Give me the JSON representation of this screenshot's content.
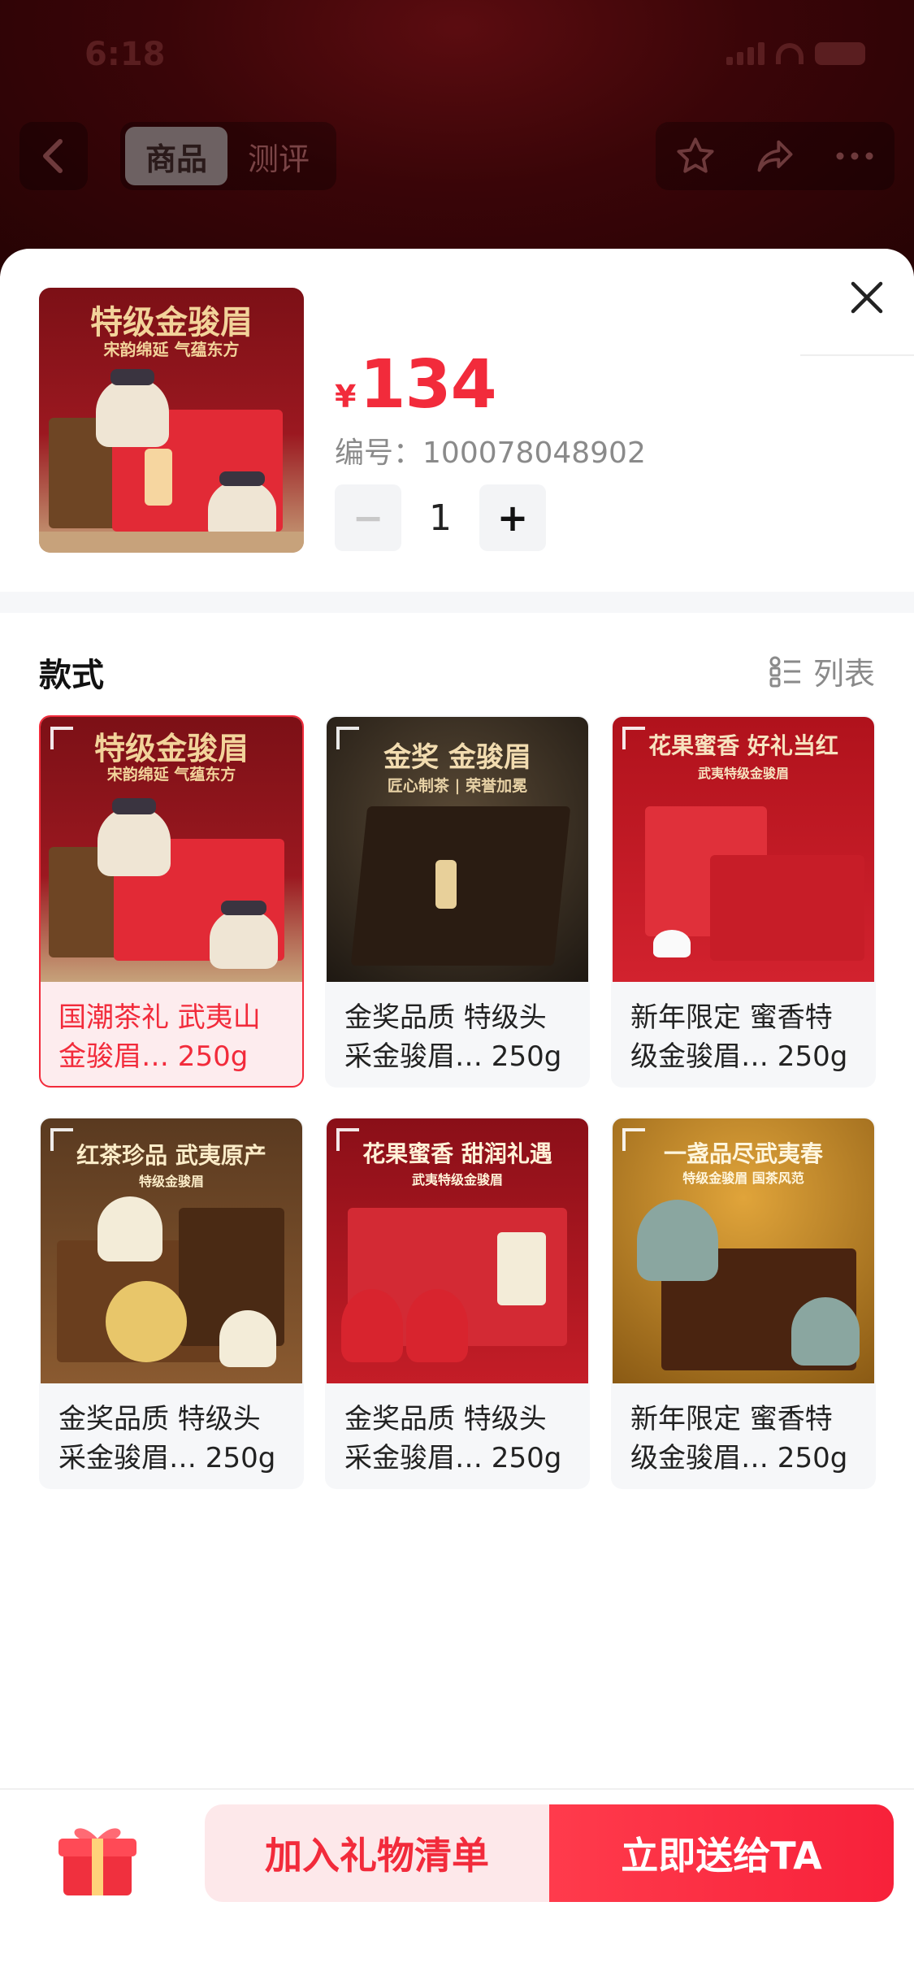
{
  "status_bar": {
    "time": "6:18"
  },
  "header": {
    "tabs": [
      {
        "label": "商品",
        "active": true
      },
      {
        "label": "测评",
        "active": false
      }
    ]
  },
  "sheet": {
    "price": {
      "currency": "¥",
      "value": "134"
    },
    "sku": {
      "label": "编号：",
      "value": "100078048902"
    },
    "quantity": {
      "value": "1",
      "minus": "−",
      "plus": "+"
    },
    "thumb_title": "特级金骏眉",
    "thumb_subtitle": "宋韵绵延 气蕴东方"
  },
  "styles_section": {
    "title": "款式",
    "view_toggle": "列表",
    "items": [
      {
        "caption": "国潮茶礼 武夷山金骏眉… 250g",
        "selected": true,
        "art_title": "特级金骏眉",
        "art_sub": "宋韵绵延 气蕴东方"
      },
      {
        "caption": "金奖品质 特级头采金骏眉… 250g",
        "selected": false,
        "art_title": "金奖 金骏眉",
        "art_sub": "匠心制茶 | 荣誉加冕"
      },
      {
        "caption": "新年限定 蜜香特级金骏眉… 250g",
        "selected": false,
        "art_title": "花果蜜香 好礼当红",
        "art_sub": "武夷特级金骏眉"
      },
      {
        "caption": "金奖品质 特级头采金骏眉… 250g",
        "selected": false,
        "art_title": "红茶珍品 武夷原产",
        "art_sub": "特级金骏眉"
      },
      {
        "caption": "金奖品质 特级头采金骏眉… 250g",
        "selected": false,
        "art_title": "花果蜜香 甜润礼遇",
        "art_sub": "武夷特级金骏眉"
      },
      {
        "caption": "新年限定 蜜香特级金骏眉… 250g",
        "selected": false,
        "art_title": "一盏品尽武夷春",
        "art_sub": "特级金骏眉 国茶风范"
      }
    ]
  },
  "bottom_bar": {
    "add_label": "加入礼物清单",
    "send_label": "立即送给TA"
  },
  "colors": {
    "accent": "#f22b3b",
    "accent_light": "#fde8ea"
  }
}
